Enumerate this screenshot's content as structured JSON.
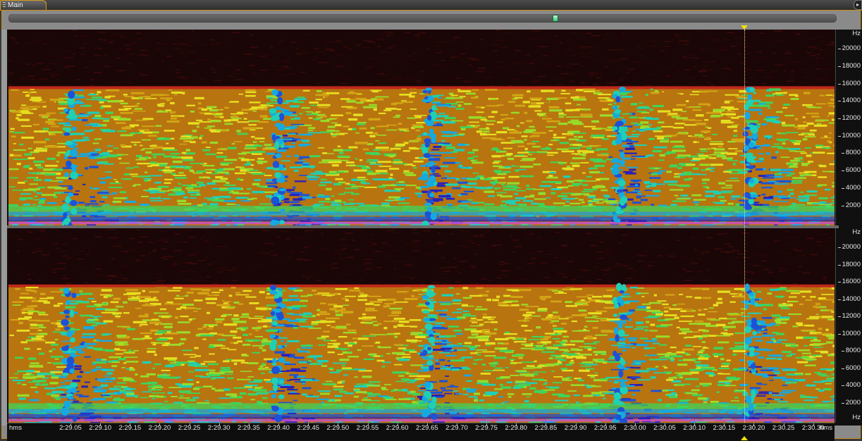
{
  "window": {
    "tab_label": "Main",
    "corner_glyph": "▸"
  },
  "scrollbar": {
    "thumb_icon": "scroll-thumb"
  },
  "freq_axis": {
    "unit": "Hz",
    "ticks": [
      "20000",
      "18000",
      "16000",
      "14000",
      "12000",
      "10000",
      "8000",
      "6000",
      "4000",
      "2000"
    ]
  },
  "time_axis": {
    "unit_left": "hms",
    "unit_right": "hms",
    "ticks": [
      "2:29.05",
      "2:29.10",
      "2:29.15",
      "2:29.20",
      "2:29.25",
      "2:29.30",
      "2:29.35",
      "2:29.40",
      "2:29.45",
      "2:29.50",
      "2:29.55",
      "2:29.60",
      "2:29.65",
      "2:29.70",
      "2:29.75",
      "2:29.80",
      "2:29.85",
      "2:29.90",
      "2:29.95",
      "2:30.00",
      "2:30.05",
      "2:30.10",
      "2:30.15",
      "2:30.20",
      "2:30.25",
      "2:30.30"
    ]
  },
  "colors": {
    "accent": "#d99a1a",
    "playhead": "#f2e000",
    "background": "#1a0606"
  }
}
